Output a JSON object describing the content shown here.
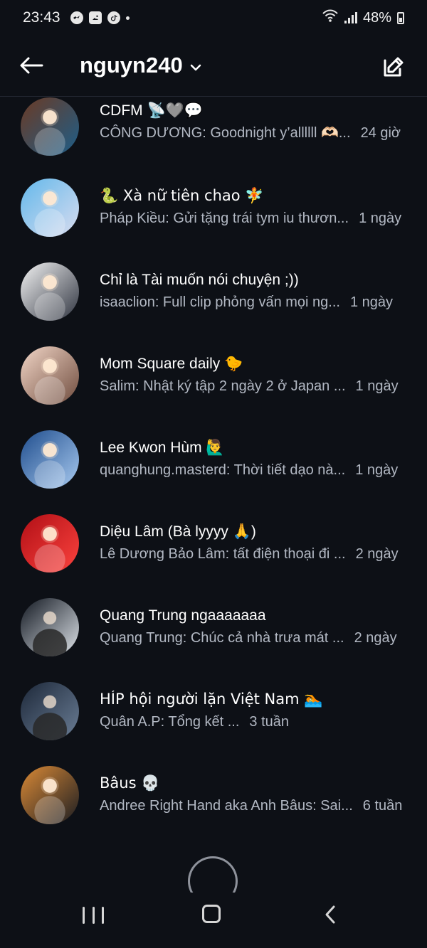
{
  "status_bar": {
    "time": "23:43",
    "battery_text": "48%",
    "icons": [
      "messenger-icon",
      "gallery-icon",
      "tiktok-icon",
      "notification-dot-icon",
      "wifi-icon",
      "signal-icon",
      "battery-icon"
    ]
  },
  "header": {
    "title": "nguyn240",
    "back_icon": "back-arrow-icon",
    "dropdown_icon": "chevron-down-icon",
    "compose_icon": "compose-icon"
  },
  "chats": [
    {
      "name": "CDFM 📡🩶💬",
      "preview": "CÔNG DƯƠNG: Goodnight y’allllll 🫶🏻...",
      "time": "24 giờ",
      "avatar_color_a": "#6b3a24",
      "avatar_color_b": "#1d5e89"
    },
    {
      "name": "🐍 Xà nữ tiên chao 🧚",
      "preview": "Pháp Kiều: Gửi tặng trái tym iu thươn...",
      "time": "1 ngày",
      "avatar_color_a": "#63b8eb",
      "avatar_color_b": "#d8dcef"
    },
    {
      "name": "Chỉ là Tài muốn nói chuyện ;))",
      "preview": "isaaclion: Full clip phỏng vấn mọi ng...",
      "time": "1 ngày",
      "avatar_color_a": "#f4f4f4",
      "avatar_color_b": "#2f3440"
    },
    {
      "name": "Mom Square daily 🐤",
      "preview": "Salim: Nhật ký tập 2 ngày 2 ở Japan ...",
      "time": "1 ngày",
      "avatar_color_a": "#f2d6c7",
      "avatar_color_b": "#6f4c3e"
    },
    {
      "name": "Lee Kwon Hùm 🙋‍♂️",
      "preview": "quanghung.masterd: Thời tiết dạo nà...",
      "time": "1 ngày",
      "avatar_color_a": "#1f4d8d",
      "avatar_color_b": "#a7c9ef"
    },
    {
      "name": "Diệu Lâm (Bà lyyyy 🙏)",
      "preview": "Lê Dương Bảo Lâm: tất điện thoại đi ...",
      "time": "2 ngày",
      "avatar_color_a": "#b10f16",
      "avatar_color_b": "#fc433e"
    },
    {
      "name": "Quang Trung ngaaaaaaa",
      "preview": "Quang Trung: Chúc cả nhà trưa mát ...",
      "time": "2 ngày",
      "avatar_color_a": "#121821",
      "avatar_color_b": "#dfe4ea"
    },
    {
      "name": "HÍP hội người lặn Việt Nam 🏊",
      "preview": "Quân A.P: Tổng kết ...",
      "time": "3 tuần",
      "avatar_color_a": "#1d2839",
      "avatar_color_b": "#6b7e96"
    },
    {
      "name": "Bâus 💀",
      "preview": "Andree Right Hand aka Anh Bâus: Sai...",
      "time": "6 tuần",
      "avatar_color_a": "#db8a36",
      "avatar_color_b": "#1b1d22"
    }
  ],
  "nav": {
    "recent_icon": "recent-apps-icon",
    "home_icon": "home-icon",
    "back_icon": "back-icon"
  }
}
